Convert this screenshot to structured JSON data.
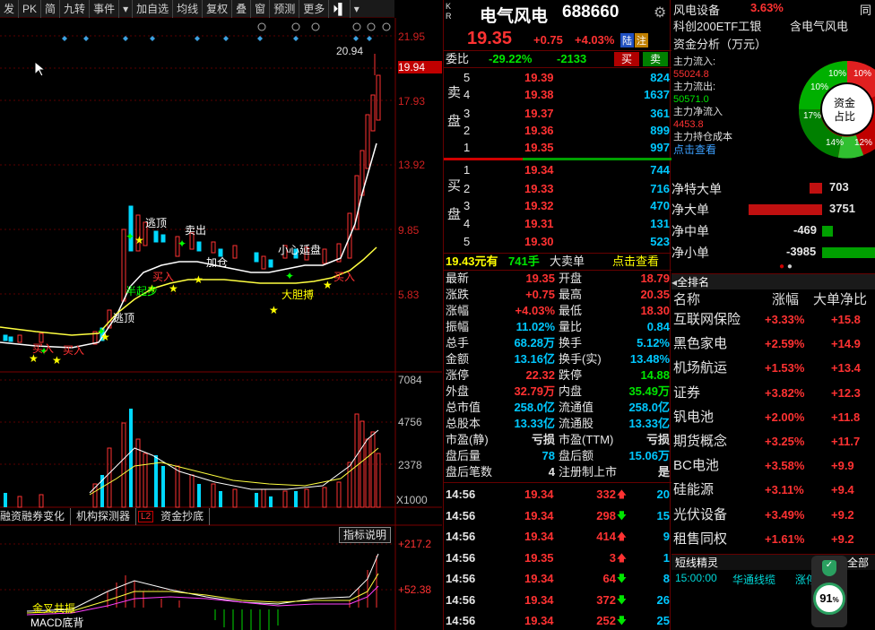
{
  "toolbar": {
    "items": [
      "发",
      "PK",
      "简",
      "九转",
      "事件",
      "加自选",
      "均线",
      "复权",
      "叠",
      "窗",
      "预测",
      "更多"
    ]
  },
  "chart": {
    "price_ticks": [
      "21.95",
      "19.94",
      "17.93",
      "13.92",
      "9.85",
      "5.83"
    ],
    "peak_label": "20.94",
    "vol_ticks": [
      "7084",
      "4756",
      "2378",
      "X1000"
    ],
    "tabs": [
      "融资融券变化",
      "机构探测器",
      "L2",
      "资金抄底"
    ],
    "indicator_btn": "指标说明",
    "macd_ticks": [
      "+217.2",
      "+52.38"
    ],
    "annotations": [
      "逃顶",
      "卖出",
      "加仓",
      "小心延盘",
      "买入",
      "买入",
      "大胆搏",
      "半起步",
      "逃顶",
      "买入",
      "买入",
      "金叉共振",
      "MACD底背"
    ]
  },
  "quote": {
    "market_tag": "K\nR",
    "name": "电气风电",
    "code": "688660",
    "price": "19.35",
    "change": "+0.75",
    "pct": "+4.03%",
    "badge1": "陆",
    "badge2": "注",
    "weibi_label": "委比",
    "weibi": "-29.22%",
    "weicha": "-2133",
    "buy_btn": "买",
    "sell_btn": "卖",
    "sell_side": "卖\n\n盘",
    "buy_side": "买\n\n盘",
    "asks": [
      {
        "n": "5",
        "p": "19.39",
        "v": "824"
      },
      {
        "n": "4",
        "p": "19.38",
        "v": "1637"
      },
      {
        "n": "3",
        "p": "19.37",
        "v": "361"
      },
      {
        "n": "2",
        "p": "19.36",
        "v": "899"
      },
      {
        "n": "1",
        "p": "19.35",
        "v": "997"
      }
    ],
    "bids": [
      {
        "n": "1",
        "p": "19.34",
        "v": "744"
      },
      {
        "n": "2",
        "p": "19.33",
        "v": "716"
      },
      {
        "n": "3",
        "p": "19.32",
        "v": "470"
      },
      {
        "n": "4",
        "p": "19.31",
        "v": "131"
      },
      {
        "n": "5",
        "p": "19.30",
        "v": "523"
      }
    ],
    "big_order": {
      "price": "19.43元有",
      "lots": "741手",
      "label": "大卖单",
      "link": "点击查看"
    },
    "stats": [
      [
        "最新",
        "19.35",
        "开盘",
        "18.79"
      ],
      [
        "涨跌",
        "+0.75",
        "最高",
        "20.35"
      ],
      [
        "涨幅",
        "+4.03%",
        "最低",
        "18.30"
      ],
      [
        "振幅",
        "11.02%",
        "量比",
        "0.84"
      ],
      [
        "总手",
        "68.28万",
        "换手",
        "5.12%"
      ],
      [
        "金额",
        "13.16亿",
        "换手(实)",
        "13.48%"
      ],
      [
        "涨停",
        "22.32",
        "跌停",
        "14.88"
      ],
      [
        "外盘",
        "32.79万",
        "内盘",
        "35.49万"
      ],
      [
        "总市值",
        "258.0亿",
        "流通值",
        "258.0亿"
      ],
      [
        "总股本",
        "13.33亿",
        "流通股",
        "13.33亿"
      ],
      [
        "市盈(静)",
        "亏损",
        "市盈(TTM)",
        "亏损"
      ],
      [
        "盘后量",
        "78",
        "盘后额",
        "15.06万"
      ],
      [
        "盘后笔数",
        "4",
        "注册制上市",
        "是"
      ]
    ],
    "ticks": [
      {
        "t": "14:56",
        "p": "19.34",
        "v": "332",
        "d": "up",
        "n": "20"
      },
      {
        "t": "14:56",
        "p": "19.34",
        "v": "298",
        "d": "down",
        "n": "15"
      },
      {
        "t": "14:56",
        "p": "19.34",
        "v": "414",
        "d": "up",
        "n": "9"
      },
      {
        "t": "14:56",
        "p": "19.35",
        "v": "3",
        "d": "up",
        "n": "1"
      },
      {
        "t": "14:56",
        "p": "19.34",
        "v": "64",
        "d": "down",
        "n": "8"
      },
      {
        "t": "14:56",
        "p": "19.34",
        "v": "372",
        "d": "down",
        "n": "26"
      },
      {
        "t": "14:56",
        "p": "19.34",
        "v": "252",
        "d": "down",
        "n": "25"
      }
    ]
  },
  "right": {
    "sector": "风电设备",
    "sector_pct": "3.63%",
    "etf": "科创200ETF工银",
    "concept": "含电气风电",
    "fund_title": "资金分析（万元）",
    "flows": [
      [
        "主力流入:",
        "55024.8"
      ],
      [
        "主力流出:",
        "50571.0"
      ],
      [
        "主力净流入",
        "4453.8"
      ],
      [
        "主力持仓成本",
        ""
      ]
    ],
    "flow_link": "点击查看",
    "donut_center": "资金\n占比",
    "donut_labels": [
      "10%",
      "10%",
      "10%",
      "17%",
      "14%",
      "12%"
    ],
    "net_rows": [
      [
        "净特大单",
        "703"
      ],
      [
        "净大单",
        "3751"
      ],
      [
        "净中单",
        "-469"
      ],
      [
        "净小单",
        "-3985"
      ]
    ],
    "rank_title": "全排名",
    "rank_headers": [
      "名称",
      "涨幅",
      "大单净比"
    ],
    "rank": [
      [
        "互联网保险",
        "+3.33%",
        "+15.8"
      ],
      [
        "黑色家电",
        "+2.59%",
        "+14.9"
      ],
      [
        "机场航运",
        "+1.53%",
        "+13.4"
      ],
      [
        "证券",
        "+3.82%",
        "+12.3"
      ],
      [
        "钒电池",
        "+2.00%",
        "+11.8"
      ],
      [
        "期货概念",
        "+3.25%",
        "+11.7"
      ],
      [
        "BC电池",
        "+3.58%",
        "+9.9"
      ],
      [
        "硅能源",
        "+3.11%",
        "+9.4"
      ],
      [
        "光伏设备",
        "+3.49%",
        "+9.2"
      ],
      [
        "租售同权",
        "+1.61%",
        "+9.2"
      ]
    ],
    "short_title": "短线精灵",
    "short_all": "全部",
    "short_row": [
      "15:00:00",
      "华通线缆",
      "涨停"
    ],
    "score": "91",
    "score_unit": "%",
    "cut_label": "同"
  },
  "colors": {
    "up": "#ff3232",
    "down": "#00e600",
    "accent": "#00c8ff"
  }
}
